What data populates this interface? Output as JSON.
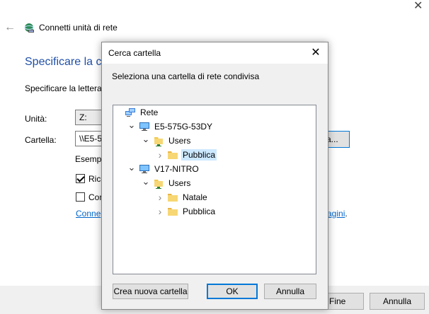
{
  "wizard": {
    "title": "Connetti unità di rete",
    "heading": "Specificare la ca",
    "instruction": "Specificare la lettera",
    "drive_label": "Unità:",
    "drive_value": "Z:",
    "folder_label": "Cartella:",
    "folder_value": "\\\\E5-5",
    "browse_label": "a...",
    "example_label": "Esempi",
    "checkbox_reconnect": "Ricc",
    "checkbox_reconnect_checked": true,
    "checkbox_credentials": "Con",
    "checkbox_credentials_checked": false,
    "link_left": "Conne",
    "link_right": "agini",
    "link_right_suffix": ".",
    "finish_button": "Fine",
    "cancel_button": "Annulla"
  },
  "dialog": {
    "title": "Cerca cartella",
    "instruction": "Seleziona una cartella di rete condivisa",
    "tree": [
      {
        "label": "Rete",
        "level": 0,
        "icon": "network-icon",
        "expander": "none"
      },
      {
        "label": "E5-575G-53DY",
        "level": 1,
        "icon": "computer-icon",
        "expander": "expanded"
      },
      {
        "label": "Users",
        "level": 2,
        "icon": "shared-folder-icon",
        "expander": "expanded"
      },
      {
        "label": "Pubblica",
        "level": 3,
        "icon": "folder-icon",
        "expander": "collapsed",
        "selected": true
      },
      {
        "label": "V17-NITRO",
        "level": 1,
        "icon": "computer-icon",
        "expander": "expanded"
      },
      {
        "label": "Users",
        "level": 2,
        "icon": "shared-folder-icon",
        "expander": "expanded"
      },
      {
        "label": "Natale",
        "level": 3,
        "icon": "folder-icon",
        "expander": "collapsed"
      },
      {
        "label": "Pubblica",
        "level": 3,
        "icon": "folder-icon",
        "expander": "collapsed"
      }
    ],
    "new_folder_button": "Crea nuova cartella",
    "ok_button": "OK",
    "cancel_button": "Annulla"
  },
  "colors": {
    "accent": "#0078d7",
    "heading": "#1f4fa8",
    "link": "#0066cc",
    "selection": "#cce8ff"
  }
}
